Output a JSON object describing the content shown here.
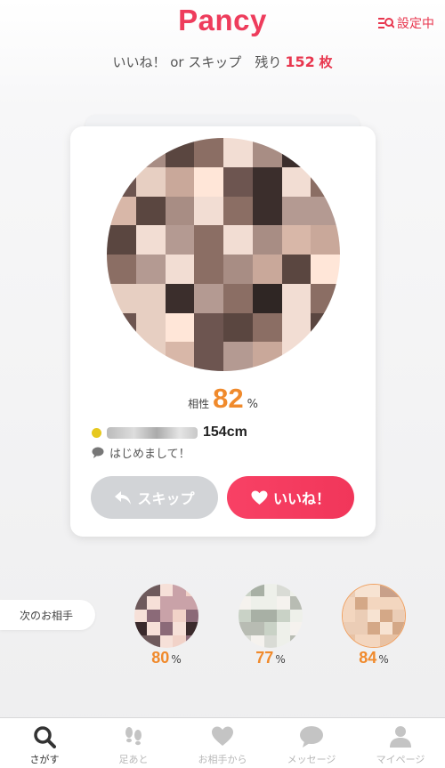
{
  "header": {
    "app_name": "Pancy",
    "settings_label": "設定中",
    "prompt": "いいね！ or スキップ　残り",
    "remaining_count": "152",
    "remaining_unit": "枚"
  },
  "profile": {
    "compat_label": "相性",
    "compat_value": "82",
    "compat_unit": "%",
    "height": "154cm",
    "greeting": "はじめまして！",
    "skip_label": "スキップ",
    "like_label": "いいね！"
  },
  "next": {
    "label": "次のお相手",
    "candidates": [
      {
        "value": "80",
        "unit": "%"
      },
      {
        "value": "77",
        "unit": "%"
      },
      {
        "value": "84",
        "unit": "%"
      }
    ]
  },
  "tabs": [
    {
      "label": "さがす",
      "icon": "search-icon"
    },
    {
      "label": "足あと",
      "icon": "footprint-icon"
    },
    {
      "label": "お相手から",
      "icon": "heart-icon"
    },
    {
      "label": "メッセージ",
      "icon": "message-icon"
    },
    {
      "label": "マイページ",
      "icon": "person-icon"
    }
  ],
  "colors": {
    "brand": "#ee3c5c",
    "accent": "#f08a2c",
    "like": "#f84165",
    "skip": "#d2d4d7"
  }
}
